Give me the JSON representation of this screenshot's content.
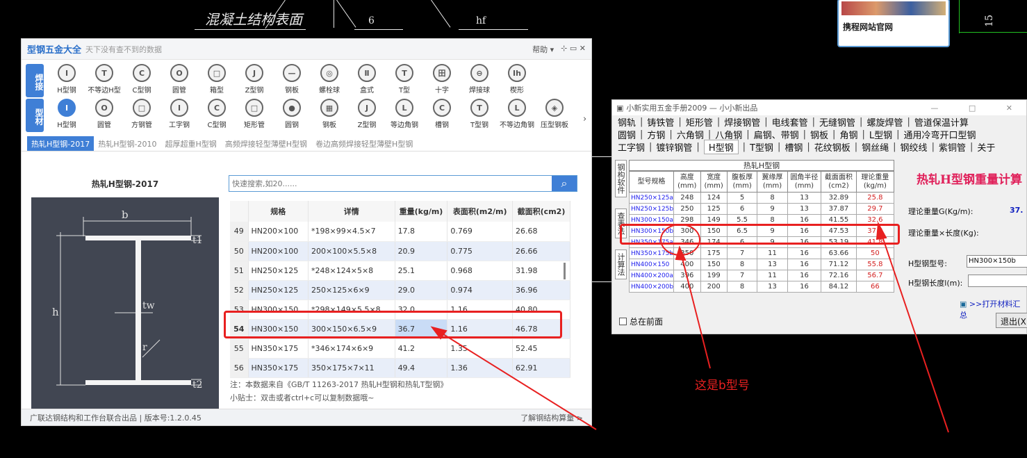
{
  "cad": {
    "label_surface": "混凝土结构表面",
    "label_6": "6",
    "label_hf": "hf",
    "label_15": "15"
  },
  "card": {
    "title": "携程网站官网"
  },
  "app1": {
    "title": "型钢五金大全",
    "subtitle": "天下没有查不到的数据",
    "help": "帮助 ▾",
    "win_controls": "⊹  ▭  ✕",
    "weld_category": "焊接",
    "weld_tools": [
      {
        "icon": "I",
        "label": "H型钢"
      },
      {
        "icon": "T",
        "label": "不等边H型"
      },
      {
        "icon": "C",
        "label": "C型钢"
      },
      {
        "icon": "O",
        "label": "圆管"
      },
      {
        "icon": "□",
        "label": "箱型"
      },
      {
        "icon": "J",
        "label": "Z型钢"
      },
      {
        "icon": "—",
        "label": "钢板"
      },
      {
        "icon": "◎",
        "label": "螺栓球"
      },
      {
        "icon": "Ⅱ",
        "label": "盒式"
      },
      {
        "icon": "T",
        "label": "T型"
      },
      {
        "icon": "田",
        "label": "十字"
      },
      {
        "icon": "⊖",
        "label": "焊接球"
      },
      {
        "icon": "Ih",
        "label": "楔形"
      }
    ],
    "profile_category": "型材",
    "profile_tools": [
      {
        "icon": "I",
        "label": "H型钢"
      },
      {
        "icon": "O",
        "label": "圆管"
      },
      {
        "icon": "□",
        "label": "方钢管"
      },
      {
        "icon": "I",
        "label": "工字钢"
      },
      {
        "icon": "C",
        "label": "C型钢"
      },
      {
        "icon": "□",
        "label": "矩形管"
      },
      {
        "icon": "●",
        "label": "圆钢"
      },
      {
        "icon": "▦",
        "label": "钢板"
      },
      {
        "icon": "J",
        "label": "Z型钢"
      },
      {
        "icon": "L",
        "label": "等边角钢"
      },
      {
        "icon": "C",
        "label": "槽钢"
      },
      {
        "icon": "T",
        "label": "T型钢"
      },
      {
        "icon": "L",
        "label": "不等边角钢"
      },
      {
        "icon": "◈",
        "label": "压型钢板"
      }
    ],
    "tabs": [
      "热轧H型钢-2017",
      "热轧H型钢-2010",
      "超厚超重H型钢",
      "高频焊接轻型薄壁H型钢",
      "卷边高频焊接轻型薄壁H型钢"
    ],
    "panel_title": "热轧H型钢-2017",
    "diagram": {
      "b": "b",
      "h": "h",
      "tw": "tw",
      "r": "r",
      "t1": "t1",
      "t2": "t2"
    },
    "search_placeholder": "快速搜索,如20......",
    "table_headers": [
      "规格",
      "详情",
      "重量(kg/m)",
      "表面积(m2/m)",
      "截面积(cm2)"
    ],
    "rows": [
      {
        "n": "49",
        "spec": "HN200×100",
        "detail": "*198×99×4.5×7",
        "weight": "17.8",
        "area": "0.769",
        "section": "26.68"
      },
      {
        "n": "50",
        "spec": "HN200×100",
        "detail": "200×100×5.5×8",
        "weight": "20.9",
        "area": "0.775",
        "section": "26.66"
      },
      {
        "n": "51",
        "spec": "HN250×125",
        "detail": "*248×124×5×8",
        "weight": "25.1",
        "area": "0.968",
        "section": "31.98"
      },
      {
        "n": "52",
        "spec": "HN250×125",
        "detail": "250×125×6×9",
        "weight": "29.0",
        "area": "0.974",
        "section": "36.96"
      },
      {
        "n": "53",
        "spec": "HN300×150",
        "detail": "*298×149×5.5×8",
        "weight": "32.0",
        "area": "1.16",
        "section": "40.80"
      },
      {
        "n": "54",
        "spec": "HN300×150",
        "detail": "300×150×6.5×9",
        "weight": "36.7",
        "area": "1.16",
        "section": "46.78"
      },
      {
        "n": "55",
        "spec": "HN350×175",
        "detail": "*346×174×6×9",
        "weight": "41.2",
        "area": "1.35",
        "section": "52.45"
      },
      {
        "n": "56",
        "spec": "HN350×175",
        "detail": "350×175×7×11",
        "weight": "49.4",
        "area": "1.36",
        "section": "62.91"
      }
    ],
    "note1": "注：本数据来自《GB/T 11263-2017 热轧H型钢和热轧T型钢》",
    "note2": "小贴士：双击或者ctrl+c可以复制数据哦~",
    "footer_left": "广联达钢结构和工作台联合出品  |  版本号:1.2.0.45",
    "footer_right": "了解钢结构算量 >"
  },
  "app2": {
    "title": "小新实用五金手册2009 — 小小新出品",
    "menu_row1": [
      "钢轨",
      "铸铁管",
      "矩形管",
      "焊接钢管",
      "电线套管",
      "无缝钢管",
      "螺旋焊管",
      "管道保温计算"
    ],
    "menu_row2": [
      "圆钢",
      "方钢",
      "六角钢",
      "八角钢",
      "扁钢、带钢",
      "钢板",
      "角钢",
      "L型钢",
      "通用冷弯开口型钢"
    ],
    "menu_row3": [
      "工字钢",
      "镀锌钢管",
      "H型钢",
      "T型钢",
      "槽钢",
      "花纹钢板",
      "钢丝绳",
      "钢绞线",
      "紫铜管",
      "关于"
    ],
    "side_tabs": [
      "钢构软件",
      "查表法",
      "计算法"
    ],
    "table_caption": "热轧H型钢",
    "table_headers": [
      "型号规格",
      "高度(mm)",
      "宽度(mm)",
      "腹板厚(mm)",
      "翼缘厚(mm)",
      "圆角半径(mm)",
      "截面面积(cm2)",
      "理论重量(kg/m)"
    ],
    "rows": [
      [
        "HN250×125a",
        "248",
        "124",
        "5",
        "8",
        "13",
        "32.89",
        "25.8"
      ],
      [
        "HN250×125b",
        "250",
        "125",
        "6",
        "9",
        "13",
        "37.87",
        "29.7"
      ],
      [
        "HN300×150a",
        "298",
        "149",
        "5.5",
        "8",
        "16",
        "41.55",
        "32.6"
      ],
      [
        "HN300×150b",
        "300",
        "150",
        "6.5",
        "9",
        "16",
        "47.53",
        "37.3"
      ],
      [
        "HN350×175a",
        "346",
        "174",
        "6",
        "9",
        "16",
        "53.19",
        "41.8"
      ],
      [
        "HN350×175b",
        "350",
        "175",
        "7",
        "11",
        "16",
        "63.66",
        "50"
      ],
      [
        "HN400×150",
        "400",
        "150",
        "8",
        "13",
        "16",
        "71.12",
        "55.8"
      ],
      [
        "HN400×200a",
        "396",
        "199",
        "7",
        "11",
        "16",
        "72.16",
        "56.7"
      ],
      [
        "HN400×200b",
        "400",
        "200",
        "8",
        "13",
        "16",
        "84.12",
        "66"
      ]
    ],
    "calc_title": "热轧H型钢重量计算",
    "lbl_weight": "理论重量G(Kg/m):",
    "val_weight": "37.",
    "lbl_total": "理论重量×长度(Kg):",
    "lbl_model": "H型钢型号:",
    "val_model": "HN300×150b",
    "lbl_length": "H型钢长度l(m):",
    "link": ">>打开材料汇总",
    "ontop": "总在前面",
    "exit": "退出(X)"
  },
  "annotation": {
    "text": "这是b型号"
  }
}
